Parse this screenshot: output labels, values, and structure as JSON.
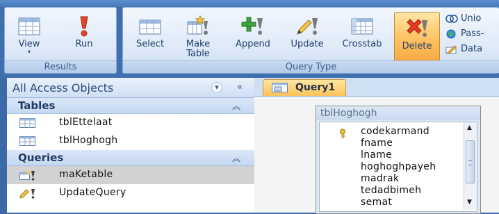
{
  "ribbon": {
    "results": {
      "caption": "Results",
      "view_label": "View",
      "run_label": "Run"
    },
    "query_type": {
      "caption": "Query Type",
      "select_label": "Select",
      "make_table_label_1": "Make",
      "make_table_label_2": "Table",
      "append_label": "Append",
      "update_label": "Update",
      "crosstab_label": "Crosstab",
      "delete_label": "Delete",
      "union_label": "Unio",
      "pass_through_label": "Pass-",
      "data_definition_label": "Data"
    }
  },
  "nav": {
    "title": "All Access Objects",
    "dropdown_glyph": "▾",
    "collapse_glyph": "«",
    "sections": [
      {
        "title": "Tables",
        "items": [
          {
            "label": "tblEttelaat"
          },
          {
            "label": "tblHoghogh"
          }
        ]
      },
      {
        "title": "Queries",
        "items": [
          {
            "label": "maKetable"
          },
          {
            "label": "UpdateQuery"
          }
        ]
      }
    ]
  },
  "query": {
    "tab_label": "Query1",
    "table": {
      "title": "tblHoghogh",
      "fields": [
        "codekarmand",
        "fname",
        "lname",
        "hoghoghpayeh",
        "madrak",
        "tedadbimeh",
        "semat"
      ]
    }
  },
  "colors": {
    "ribbon_bg": "#3f6fae",
    "active_button": "#fbc35c",
    "selected_item": "#d2d2d2"
  }
}
